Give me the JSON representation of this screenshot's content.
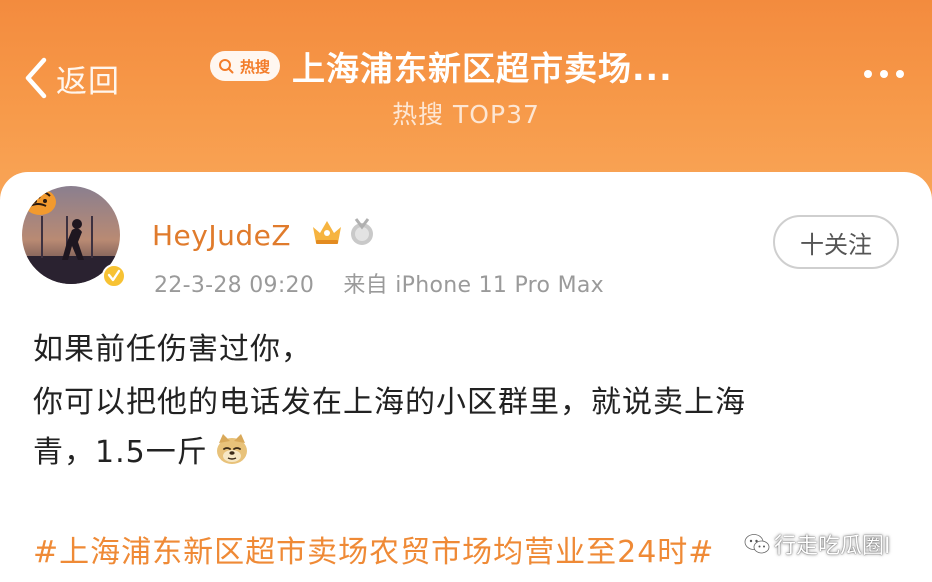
{
  "header": {
    "back_label": "返回",
    "hot_badge": "热搜",
    "title": "上海浦东新区超市卖场...",
    "subtitle": "热搜 TOP37"
  },
  "post": {
    "username": "HeyJudeZ",
    "timestamp": "22-3-28 09:20",
    "source": "来自 iPhone 11 Pro Max",
    "follow_label": "十关注",
    "lines": [
      "如果前任伤害过你，",
      "你可以把他的电话发在上海的小区群里，就说卖上海",
      "青，1.5一斤"
    ],
    "hashtag": "#上海浦东新区超市卖场农贸市场均营业至24时#"
  },
  "watermark": {
    "text": "行走吃瓜圈I"
  },
  "colors": {
    "header_orange": "#f38b3e",
    "username_orange": "#e07b2c",
    "hashtag_orange": "#ef8a36"
  }
}
